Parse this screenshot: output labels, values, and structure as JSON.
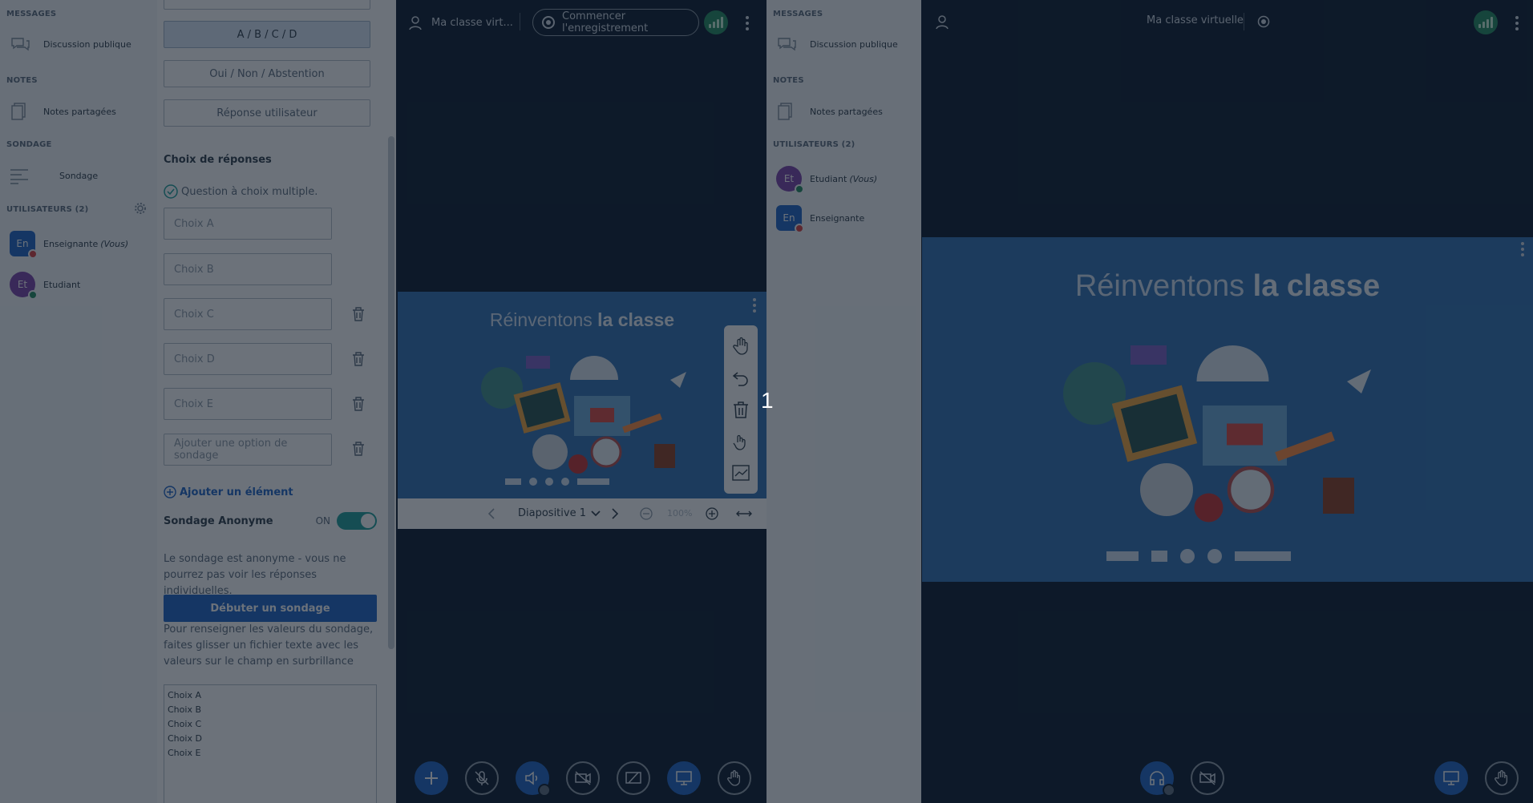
{
  "teacher": {
    "sections": {
      "messages": "MESSAGES",
      "notes": "NOTES",
      "poll": "SONDAGE",
      "users": "UTILISATEURS (2)"
    },
    "public_chat": "Discussion publique",
    "shared_notes": "Notes partagées",
    "poll_item": "Sondage",
    "users": [
      {
        "initials": "En",
        "name": "Enseignante",
        "suffix": "(Vous)",
        "color": "#1b63c6",
        "status": "#d83b3b"
      },
      {
        "initials": "Et",
        "name": "Etudiant",
        "suffix": "",
        "color": "#7a3fa8",
        "status": "#1f8a5c"
      }
    ],
    "poll": {
      "type_buttons": [
        "A / B / C / D",
        "Oui / Non / Abstention",
        "Réponse utilisateur"
      ],
      "answers_title": "Choix de réponses",
      "multiple_choice": "Question à choix multiple.",
      "choices": [
        "Choix A",
        "Choix B",
        "Choix C",
        "Choix D",
        "Choix E",
        "Ajouter une option de sondage"
      ],
      "add_item": "Ajouter un élément",
      "anonymous_label": "Sondage Anonyme",
      "anonymous_state": "ON",
      "anonymous_info": "Le sondage est anonyme - vous ne pourrez pas voir les réponses individuelles.",
      "start_button": "Débuter un sondage",
      "drag_info": "Pour renseigner les valeurs du sondage, faites glisser un fichier texte avec les valeurs sur le champ en surbrillance",
      "textarea_lines": [
        "Choix A",
        "Choix B",
        "Choix C",
        "Choix D",
        "Choix E"
      ]
    },
    "topbar": {
      "title": "Ma classe virt...",
      "record": "Commencer l'enregistrement"
    },
    "slide": {
      "title_light": "Réinventons ",
      "title_bold": "la classe"
    },
    "slide_nav": {
      "slide_label": "Diapositive 1",
      "zoom": "100%"
    }
  },
  "student": {
    "sections": {
      "messages": "MESSAGES",
      "notes": "NOTES",
      "users": "UTILISATEURS (2)"
    },
    "public_chat": "Discussion publique",
    "shared_notes": "Notes partagées",
    "users": [
      {
        "initials": "Et",
        "name": "Etudiant",
        "suffix": "(Vous)",
        "color": "#7a3fa8",
        "status": "#1f8a5c"
      },
      {
        "initials": "En",
        "name": "Enseignante",
        "suffix": "",
        "color": "#1b63c6",
        "status": "#d83b3b"
      }
    ],
    "topbar": {
      "title": "Ma classe virtuelle"
    },
    "slide": {
      "title_light": "Réinventons ",
      "title_bold": "la classe"
    }
  },
  "step_marker": "1"
}
